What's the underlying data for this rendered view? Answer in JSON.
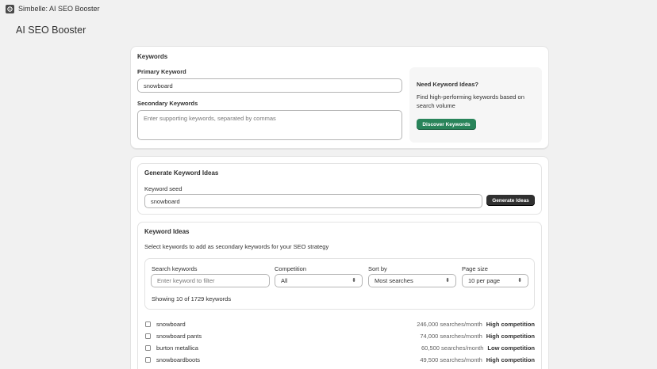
{
  "app": {
    "title": "Simbelle: AI SEO Booster"
  },
  "page": {
    "title": "AI SEO Booster"
  },
  "keywords_card": {
    "heading": "Keywords",
    "primary_label": "Primary Keyword",
    "primary_value": "snowboard",
    "secondary_label": "Secondary Keywords",
    "secondary_placeholder": "Enter supporting keywords, separated by commas",
    "ideas_box": {
      "title": "Need Keyword Ideas?",
      "description": "Find high-performing keywords based on search volume",
      "button": "Discover Keywords"
    }
  },
  "generate": {
    "heading": "Generate Keyword Ideas",
    "seed_label": "Keyword seed",
    "seed_value": "snowboard",
    "button": "Generate Ideas"
  },
  "ideas": {
    "heading": "Keyword Ideas",
    "subtitle": "Select keywords to add as secondary keywords for your SEO strategy",
    "filters": {
      "search_label": "Search keywords",
      "search_placeholder": "Enter keyword to filter",
      "competition_label": "Competition",
      "competition_value": "All",
      "sort_label": "Sort by",
      "sort_value": "Most searches",
      "page_size_label": "Page size",
      "page_size_value": "10 per page",
      "showing_text": "Showing 10 of 1729 keywords"
    },
    "rows": [
      {
        "keyword": "snowboard",
        "volume": "246,000 searches/month",
        "competition": "High competition"
      },
      {
        "keyword": "snowboard pants",
        "volume": "74,000 searches/month",
        "competition": "High competition"
      },
      {
        "keyword": "burton metallica",
        "volume": "60,500 searches/month",
        "competition": "Low competition"
      },
      {
        "keyword": "snowboardboots",
        "volume": "49,500 searches/month",
        "competition": "High competition"
      }
    ]
  },
  "icons": {
    "app": "app-logo-icon",
    "select_chevron": "select-chevron-icon"
  }
}
